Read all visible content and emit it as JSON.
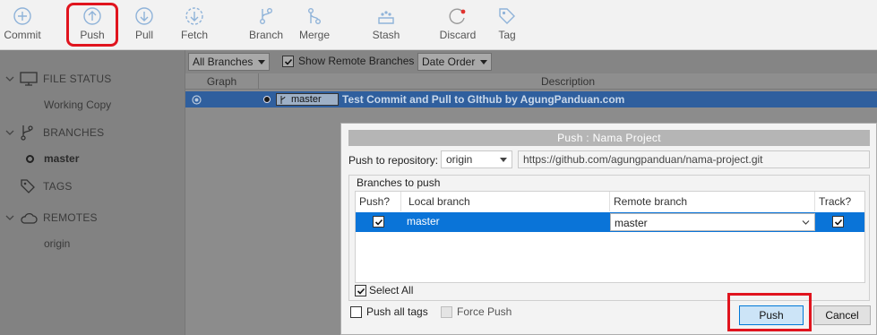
{
  "toolbar": {
    "commit": "Commit",
    "push": "Push",
    "pull": "Pull",
    "fetch": "Fetch",
    "branch": "Branch",
    "merge": "Merge",
    "stash": "Stash",
    "discard": "Discard",
    "tag": "Tag"
  },
  "sidebar": {
    "file_status": "FILE STATUS",
    "working_copy": "Working Copy",
    "branches": "BRANCHES",
    "master": "master",
    "tags": "TAGS",
    "remotes": "REMOTES",
    "origin": "origin"
  },
  "filter": {
    "branches_select": "All Branches",
    "show_remote": "Show Remote Branches",
    "order_select": "Date Order"
  },
  "history": {
    "col_graph": "Graph",
    "col_description": "Description",
    "branch_tag": "master",
    "commit_message": "Test Commit and Pull to GIthub by AgungPanduan.com"
  },
  "dialog": {
    "title": "Push :  Nama Project",
    "repo_label": "Push to repository:",
    "repo_value": "origin",
    "repo_url": "https://github.com/agungpanduan/nama-project.git",
    "group_label": "Branches to push",
    "col_push": "Push?",
    "col_local": "Local branch",
    "col_remote": "Remote branch",
    "col_track": "Track?",
    "row_local": "master",
    "row_remote": "master",
    "select_all": "Select All",
    "push_all_tags": "Push all tags",
    "force_push": "Force Push",
    "push_button": "Push",
    "cancel_button": "Cancel"
  }
}
